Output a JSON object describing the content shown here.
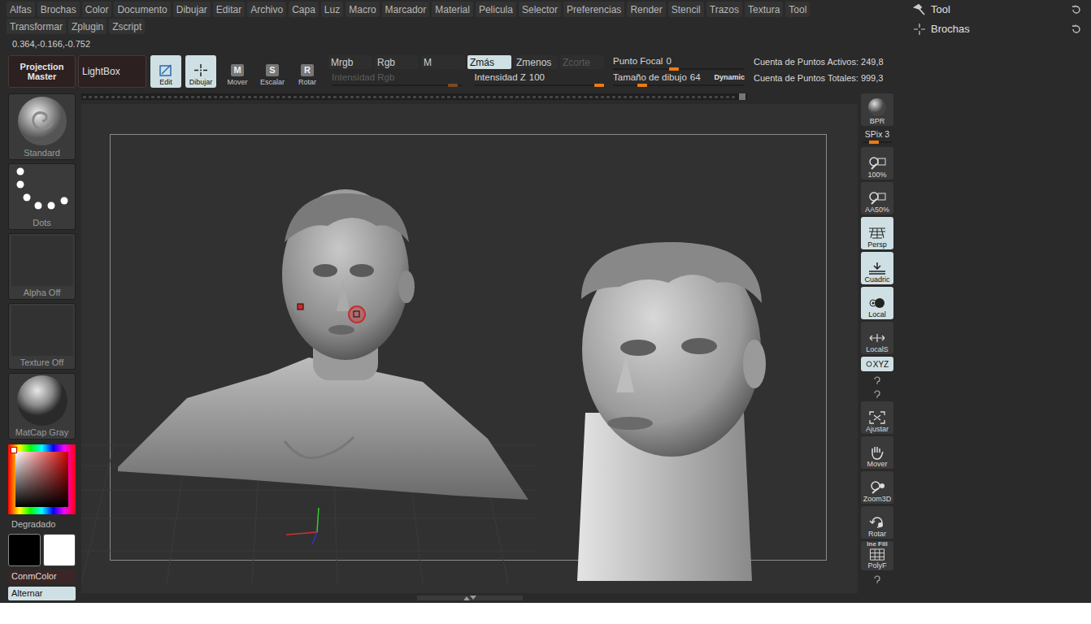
{
  "menu": [
    "Alfas",
    "Brochas",
    "Color",
    "Documento",
    "Dibujar",
    "Editar",
    "Archivo",
    "Capa",
    "Luz",
    "Macro",
    "Marcador",
    "Material",
    "Pelicula",
    "Selector",
    "Preferencias",
    "Render",
    "Stencil",
    "Trazos",
    "Textura",
    "Tool"
  ],
  "menu_row2": [
    "Transformar",
    "Zplugin",
    "Zscript"
  ],
  "palettes": [
    "Tool",
    "Brochas"
  ],
  "coordinates": "0.364,-0.166,-0.752",
  "projection_master": "Projection Master",
  "lightbox": "LightBox",
  "modes": [
    {
      "label": "Edit",
      "key": "",
      "selected": true
    },
    {
      "label": "Dibujar",
      "key": "",
      "selected": true
    },
    {
      "label": "Mover",
      "key": "M",
      "selected": false
    },
    {
      "label": "Escalar",
      "key": "S",
      "selected": false
    },
    {
      "label": "Rotar",
      "key": "R",
      "selected": false
    }
  ],
  "channels": [
    {
      "label": "Mrgb",
      "selected": false,
      "disabled": false
    },
    {
      "label": "Rgb",
      "selected": false,
      "disabled": false
    },
    {
      "label": "M",
      "selected": false,
      "disabled": false
    },
    {
      "label": "Zmás",
      "selected": true,
      "disabled": false
    },
    {
      "label": "Zmenos",
      "selected": false,
      "disabled": false
    },
    {
      "label": "Zcorte",
      "selected": false,
      "disabled": true
    }
  ],
  "intensity_sliders": [
    {
      "label": "Intensidad Rgb",
      "value": "",
      "level": 0.97,
      "disabled": true
    },
    {
      "label": "Intensidad Z",
      "value": "100",
      "level": 1,
      "disabled": false
    }
  ],
  "draw_sliders": [
    {
      "label": "Punto Focal",
      "value": "0",
      "level": 0.5
    },
    {
      "label": "Tamaño de dibujo",
      "value": "64",
      "level": 0.26
    }
  ],
  "dynamic": "Dynamic",
  "stats": [
    "Cuenta de Puntos Activos: 249,8",
    "Cuenta de Puntos Totales: 999,3"
  ],
  "left_shelf": [
    {
      "label": "Standard",
      "kind": "brush"
    },
    {
      "label": "Dots",
      "kind": "stroke"
    },
    {
      "label": "Alpha Off",
      "kind": "empty"
    },
    {
      "label": "Texture Off",
      "kind": "empty"
    },
    {
      "label": "MatCap Gray",
      "kind": "material"
    }
  ],
  "color_picker": {
    "hue": "#d00000"
  },
  "gradient_label": "Degradado",
  "swatches": [
    {
      "color": "#000000",
      "selected": true
    },
    {
      "color": "#ffffff",
      "selected": false
    }
  ],
  "color_buttons": [
    {
      "label": "ConmColor",
      "selected": false
    },
    {
      "label": "Alternar",
      "selected": true
    }
  ],
  "right_shelf": [
    {
      "kind": "button",
      "label": "BPR",
      "selected": false
    },
    {
      "kind": "slider",
      "label": "SPix 3",
      "level": 0.4
    },
    {
      "kind": "button",
      "label": "100%",
      "selected": false
    },
    {
      "kind": "button",
      "label": "AA50%",
      "selected": false
    },
    {
      "kind": "button",
      "label": "Persp",
      "selected": true
    },
    {
      "kind": "button",
      "label": "Cuadric",
      "selected": true
    },
    {
      "kind": "button",
      "label": "Local",
      "selected": true
    },
    {
      "kind": "button",
      "label": "LocalS",
      "selected": false
    },
    {
      "kind": "toggle",
      "label": "XYZ",
      "selected": true
    },
    {
      "kind": "mini"
    },
    {
      "kind": "mini"
    },
    {
      "kind": "button",
      "label": "Ajustar",
      "selected": false
    },
    {
      "kind": "button",
      "label": "Mover",
      "selected": false
    },
    {
      "kind": "button",
      "label": "Zoom3D",
      "selected": false
    },
    {
      "kind": "button",
      "label": "Rotar",
      "selected": false
    },
    {
      "kind": "button",
      "label": "PolyF",
      "caption": "Ine Fill",
      "selected": false
    },
    {
      "kind": "mini"
    }
  ]
}
